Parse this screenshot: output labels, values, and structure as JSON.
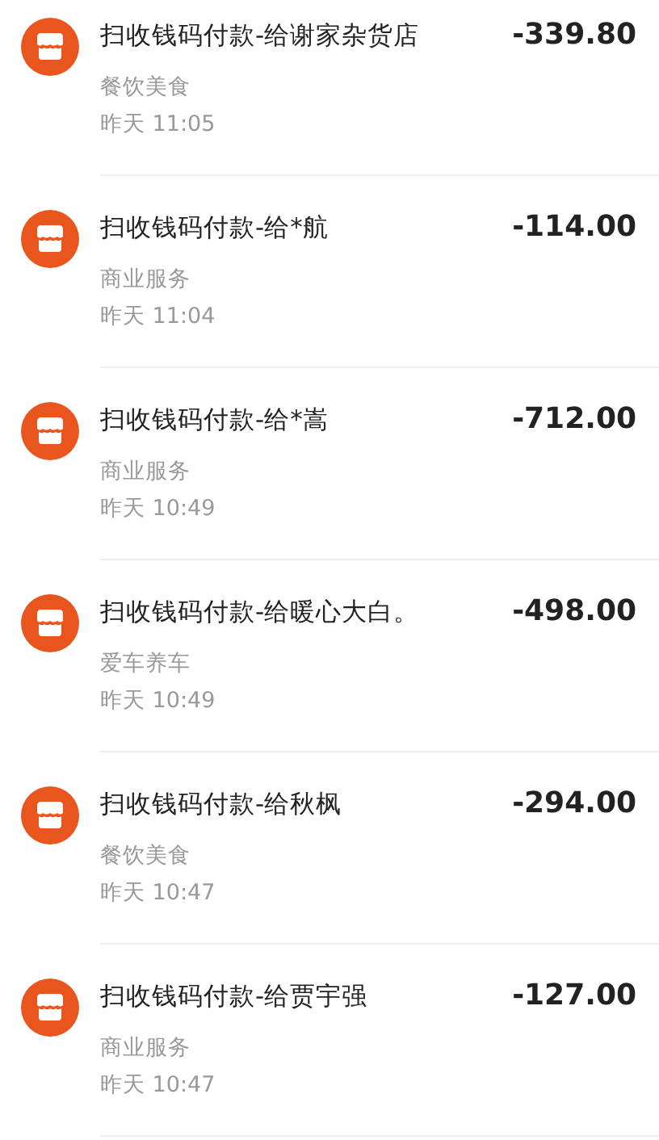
{
  "transactions": [
    {
      "title": "扫收钱码付款-给谢家杂货店",
      "category": "餐饮美食",
      "time": "昨天 11:05",
      "amount": "-339.80"
    },
    {
      "title": "扫收钱码付款-给*航",
      "category": "商业服务",
      "time": "昨天 11:04",
      "amount": "-114.00"
    },
    {
      "title": "扫收钱码付款-给*嵩",
      "category": "商业服务",
      "time": "昨天 10:49",
      "amount": "-712.00"
    },
    {
      "title": "扫收钱码付款-给暖心大白。",
      "category": "爱车养车",
      "time": "昨天 10:49",
      "amount": "-498.00"
    },
    {
      "title": "扫收钱码付款-给秋枫",
      "category": "餐饮美食",
      "time": "昨天 10:47",
      "amount": "-294.00"
    },
    {
      "title": "扫收钱码付款-给贾宇强",
      "category": "商业服务",
      "time": "昨天 10:47",
      "amount": "-127.00"
    }
  ]
}
